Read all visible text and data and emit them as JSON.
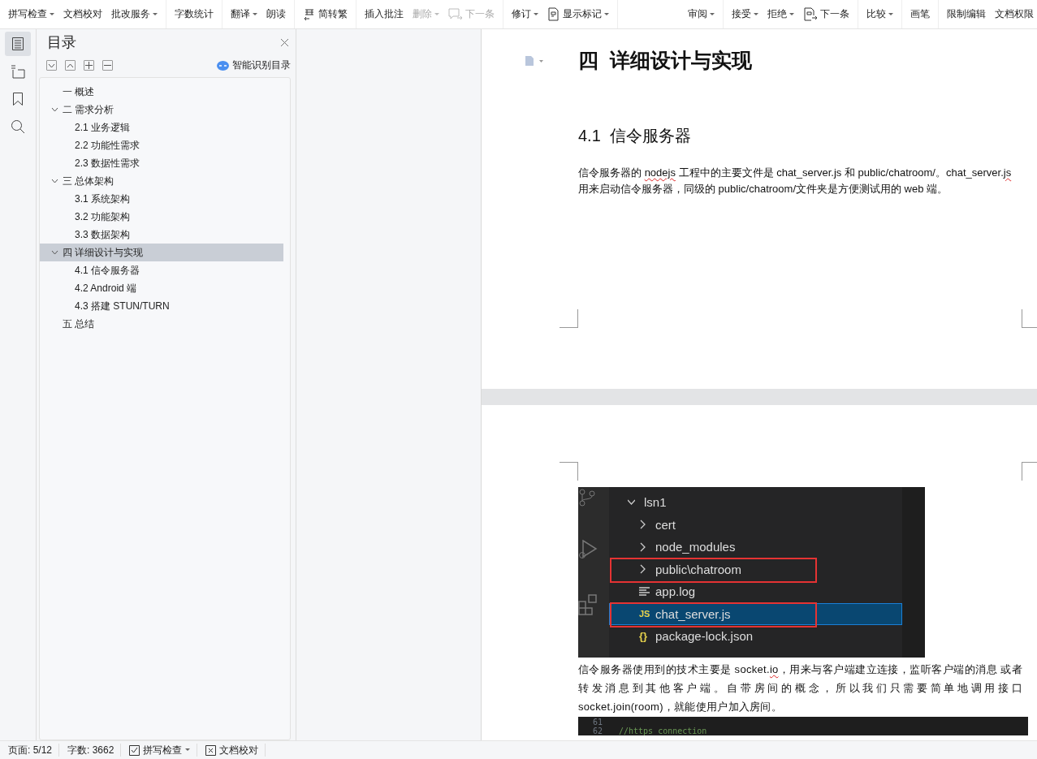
{
  "toolbar": {
    "left_groups": [
      {
        "items": [
          {
            "kind": "text",
            "label": "拼写检查",
            "dropdown": true,
            "disabled": false
          },
          {
            "kind": "text",
            "label": "文档校对",
            "dropdown": false,
            "disabled": false
          },
          {
            "kind": "text",
            "label": "批改服务",
            "dropdown": true,
            "disabled": false
          }
        ]
      },
      {
        "items": [
          {
            "kind": "text",
            "label": "字数统计",
            "dropdown": false,
            "disabled": false
          }
        ]
      },
      {
        "items": [
          {
            "kind": "text",
            "label": "翻译",
            "dropdown": true,
            "disabled": false
          },
          {
            "kind": "text",
            "label": "朗读",
            "dropdown": false,
            "disabled": false
          }
        ]
      },
      {
        "items": [
          {
            "kind": "convert",
            "label": "简转繁",
            "dropdown": false,
            "disabled": false
          }
        ]
      },
      {
        "items": [
          {
            "kind": "text",
            "label": "插入批注",
            "dropdown": false,
            "disabled": false
          },
          {
            "kind": "text",
            "label": "删除",
            "dropdown": true,
            "disabled": true
          },
          {
            "kind": "comment",
            "label": "下一条",
            "dropdown": false,
            "disabled": true
          }
        ]
      },
      {
        "items": [
          {
            "kind": "text",
            "label": "修订",
            "dropdown": true,
            "disabled": false
          },
          {
            "kind": "markup",
            "label": "显示标记",
            "dropdown": true,
            "disabled": false
          }
        ]
      }
    ],
    "right_groups": [
      {
        "items": [
          {
            "kind": "text",
            "label": "审阅",
            "dropdown": true,
            "disabled": false
          }
        ]
      },
      {
        "items": [
          {
            "kind": "text",
            "label": "接受",
            "dropdown": true,
            "disabled": false
          },
          {
            "kind": "text",
            "label": "拒绝",
            "dropdown": true,
            "disabled": false
          },
          {
            "kind": "next",
            "label": "下一条",
            "dropdown": false,
            "disabled": false
          }
        ]
      },
      {
        "items": [
          {
            "kind": "text",
            "label": "比较",
            "dropdown": true,
            "disabled": false
          }
        ]
      },
      {
        "items": [
          {
            "kind": "text",
            "label": "画笔",
            "dropdown": false,
            "disabled": false
          }
        ]
      },
      {
        "items": [
          {
            "kind": "text",
            "label": "限制编辑",
            "dropdown": false,
            "disabled": false
          },
          {
            "kind": "text",
            "label": "文档权限",
            "dropdown": false,
            "disabled": false
          }
        ]
      }
    ]
  },
  "rail": [
    {
      "kind": "toc",
      "selected": true
    },
    {
      "kind": "outline",
      "selected": false
    },
    {
      "kind": "bookmark",
      "selected": false
    },
    {
      "kind": "search",
      "selected": false
    }
  ],
  "toc": {
    "title": "目录",
    "smart_button": "智能识别目录",
    "items": [
      {
        "label": "一  概述",
        "selected": false
      },
      {
        "label": "二  需求分析",
        "expanded": true,
        "selected": false,
        "children": [
          {
            "label": "2.1  业务逻辑",
            "selected": false
          },
          {
            "label": "2.2  功能性需求",
            "selected": false
          },
          {
            "label": "2.3  数据性需求",
            "selected": false
          }
        ]
      },
      {
        "label": "三  总体架构",
        "expanded": true,
        "selected": false,
        "children": [
          {
            "label": "3.1  系统架构",
            "selected": false
          },
          {
            "label": "3.2  功能架构",
            "selected": false
          },
          {
            "label": "3.3  数据架构",
            "selected": false
          }
        ]
      },
      {
        "label": "四  详细设计与实现",
        "expanded": true,
        "selected": true,
        "children": [
          {
            "label": "4.1  信令服务器",
            "selected": false
          },
          {
            "label": "4.2 Android 端",
            "selected": false
          },
          {
            "label": "4.3  搭建  STUN/TURN",
            "selected": false
          }
        ]
      },
      {
        "label": "五  总结",
        "selected": false
      }
    ]
  },
  "document": {
    "heading1": "四  详细设计与实现",
    "heading2": "4.1  信令服务器",
    "paragraph1": [
      {
        "text": "信令服务器的 ",
        "misspelled": false
      },
      {
        "text": "nodejs",
        "misspelled": true
      },
      {
        "text": " 工程中的主要文件是 chat_server.js 和 public/chatroom/。chat_server.",
        "misspelled": false
      },
      {
        "text": "js",
        "misspelled": true
      },
      {
        "text": " 用来启动信令服务器，同级的 public/chatroom/文件夹是方便测试用的 web 端。",
        "misspelled": false
      }
    ],
    "figure": {
      "files": [
        {
          "name": "lsn1",
          "kind": "folder",
          "expanded": true,
          "selected": false,
          "highlighted": false
        },
        {
          "name": "cert",
          "kind": "folder",
          "expanded": false,
          "selected": false,
          "highlighted": false
        },
        {
          "name": "node_modules",
          "kind": "folder",
          "expanded": false,
          "selected": false,
          "highlighted": false
        },
        {
          "name": "public\\chatroom",
          "kind": "folder",
          "expanded": false,
          "selected": false,
          "highlighted": true
        },
        {
          "name": "app.log",
          "kind": "log",
          "selected": false,
          "highlighted": false
        },
        {
          "name": "chat_server.js",
          "kind": "js",
          "badge": "JS",
          "selected": true,
          "highlighted": true
        },
        {
          "name": "package-lock.json",
          "kind": "json",
          "badge": "{}",
          "selected": false,
          "highlighted": false
        }
      ]
    },
    "paragraph2": [
      {
        "text": "信令服务器使用到的技术主要是 socket.",
        "misspelled": false
      },
      {
        "text": "io",
        "misspelled": true
      },
      {
        "text": "，用来与客户端建立连接，监听客户端的消息 或者转发消息到其他客户端。自带房间的概念，所以我们只需要简单地调用接口 socket.join(room)，就能使用户加入房间。",
        "misspelled": false
      }
    ],
    "code": [
      {
        "number": "61"
      },
      {
        "number": "62",
        "text": "//https connection"
      }
    ]
  },
  "status_bar": {
    "page": "页面: 5/12",
    "words": "字数: 3662",
    "spell": "拼写检查",
    "proof": "文档校对"
  }
}
